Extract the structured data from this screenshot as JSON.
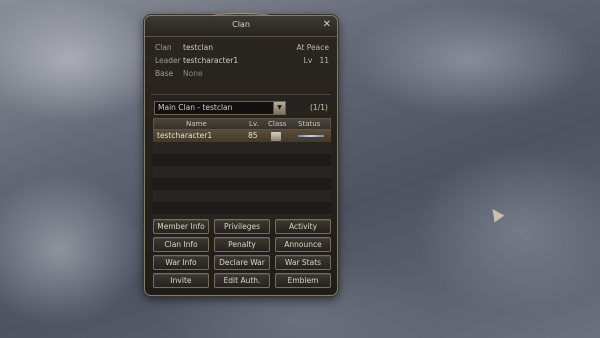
{
  "window": {
    "title": "Clan",
    "close": "✕"
  },
  "info": {
    "clan_label": "Clan",
    "clan_value": "testclan",
    "clan_state": "At Peace",
    "leader_label": "Leader",
    "leader_value": "testcharacter1",
    "lv_label": "Lv",
    "lv_value": "11",
    "base_label": "Base",
    "base_value": "None"
  },
  "selector": {
    "value": "Main Clan - testclan",
    "count": "(1/1)"
  },
  "table": {
    "headers": [
      "Name",
      "Lv.",
      "Class",
      "Status"
    ],
    "rows": [
      {
        "name": "testcharacter1",
        "lv": "85"
      }
    ]
  },
  "buttons": {
    "member_info": "Member Info",
    "privileges": "Privileges",
    "activity": "Activity",
    "clan_info": "Clan Info",
    "penalty": "Penalty",
    "announce": "Announce",
    "war_info": "War Info",
    "declare_war": "Declare War",
    "war_stats": "War Stats",
    "invite": "Invite",
    "edit_auth": "Edit Auth.",
    "emblem": "Emblem"
  },
  "colors": {
    "frame": "#8a7b63",
    "selected_row": "#5a4d38",
    "panel": "#1f1d1a"
  }
}
